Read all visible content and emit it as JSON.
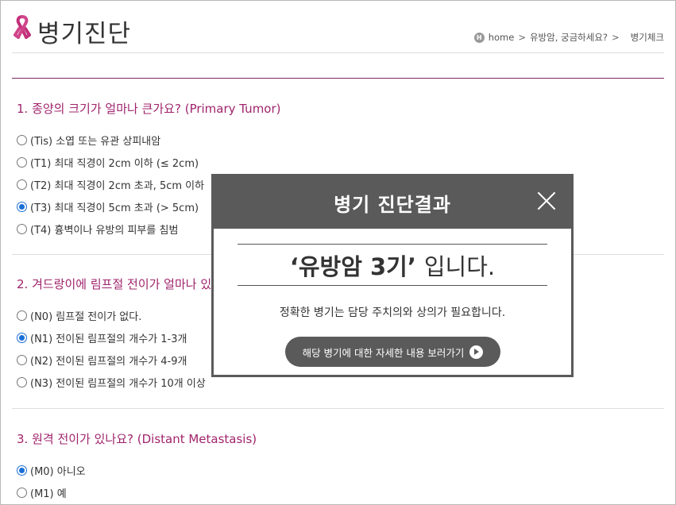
{
  "header": {
    "title": "병기진단",
    "breadcrumb": {
      "home_icon_text": "H",
      "home": "home",
      "sep1": ">",
      "section": "유방암, 궁금하세요?",
      "sep2": ">",
      "current": "병기체크"
    }
  },
  "questions": [
    {
      "title": "1. 종양의 크기가 얼마나 큰가요? (Primary Tumor)",
      "options": [
        {
          "label": "(Tis) 소엽 또는 유관 상피내암",
          "selected": false
        },
        {
          "label": "(T1) 최대 직경이 2cm 이하 (≤ 2cm)",
          "selected": false
        },
        {
          "label": "(T2) 최대 직경이 2cm 초과, 5cm 이하",
          "selected": false
        },
        {
          "label": "(T3) 최대 직경이 5cm 초과 (> 5cm)",
          "selected": true
        },
        {
          "label": "(T4) 흉벽이나 유방의 피부를 침범",
          "selected": false
        }
      ]
    },
    {
      "title": "2. 겨드랑이에 림프절 전이가 얼마나 있나요?",
      "options": [
        {
          "label": "(N0) 림프절 전이가 없다.",
          "selected": false
        },
        {
          "label": "(N1) 전이된 림프절의 개수가 1-3개",
          "selected": true
        },
        {
          "label": "(N2) 전이된 림프절의 개수가 4-9개",
          "selected": false
        },
        {
          "label": "(N3) 전이된 림프절의 개수가 10개 이상",
          "selected": false
        }
      ]
    },
    {
      "title": "3. 원격 전이가 있나요? (Distant Metastasis)",
      "options": [
        {
          "label": "(M0) 아니오",
          "selected": true
        },
        {
          "label": "(M1) 예",
          "selected": false
        }
      ]
    }
  ],
  "modal": {
    "title": "병기 진단결과",
    "result_bold": "‘유방암 3기’",
    "result_normal": "입니다.",
    "note": "정확한 병기는 담당 주치의와 상의가 필요합니다.",
    "button_label": "해당 병기에 대한 자세한 내용 보러가기"
  },
  "colors": {
    "accent": "#a0246c",
    "modal_gray": "#5a5a5a",
    "radio_selected": "#1a6fd6"
  }
}
